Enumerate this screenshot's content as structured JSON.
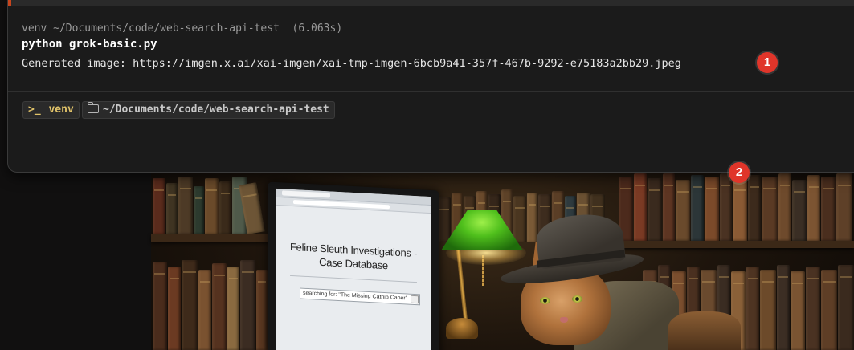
{
  "terminal": {
    "block_header": "venv ~/Documents/code/web-search-api-test  (6.063s)",
    "command": "python grok-basic.py",
    "output": "Generated image: https://imgen.x.ai/xai-imgen/xai-tmp-imgen-6bcb9a41-357f-467b-9292-e75183a2bb29.jpeg",
    "prompt": {
      "env_icon": "terminal-prompt-icon",
      "env_label": "venv",
      "path_icon": "folder-icon",
      "path_label": "~/Documents/code/web-search-api-test"
    }
  },
  "markers": [
    "1",
    "2"
  ],
  "scene": {
    "screen_title_line1": "Feline Sleuth Investigations -",
    "screen_title_line2": "Case Database",
    "screen_search": "searching for: \"The Missing Catnip Caper\""
  },
  "colors": {
    "terminal_bg": "#1b1b1b",
    "marker": "#e0352a",
    "env_chip_text": "#e2c46a",
    "lamp_green": "#4fbf1c"
  }
}
